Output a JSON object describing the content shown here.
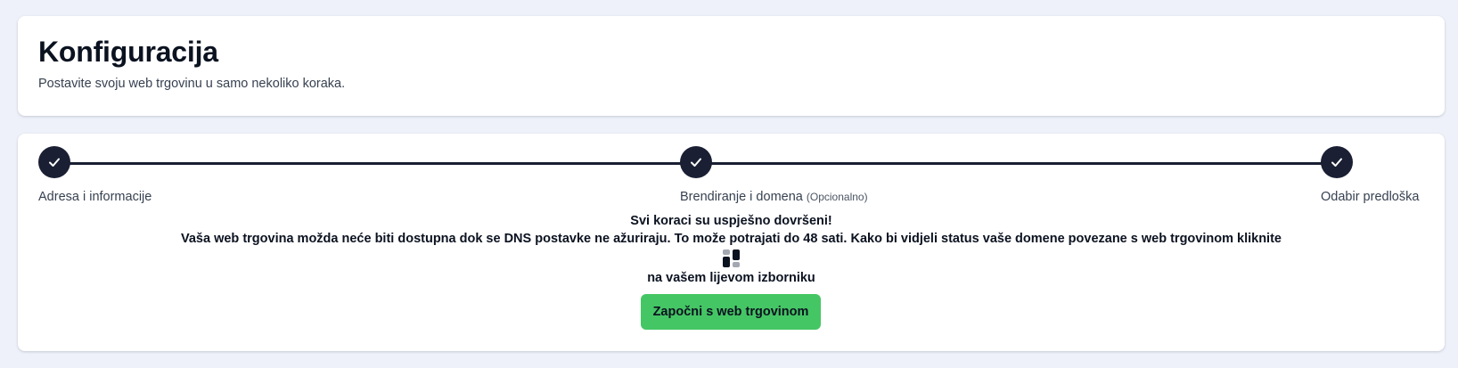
{
  "header": {
    "title": "Konfiguracija",
    "subtitle": "Postavite svoju web trgovinu u samo nekoliko koraka."
  },
  "steps": [
    {
      "label": "Adresa i informacije",
      "optional": "",
      "completed": true
    },
    {
      "label": "Brendiranje i domena",
      "optional": "(Opcionalno)",
      "completed": true
    },
    {
      "label": "Odabir predloška",
      "optional": "",
      "completed": true
    }
  ],
  "completion": {
    "title": "Svi koraci su uspješno dovršeni!",
    "message": "Vaša web trgovina možda neće biti dostupna dok se DNS postavke ne ažuriraju. To može potrajati do 48 sati. Kako bi vidjeli status vaše domene povezane s web trgovinom kliknite",
    "icon": "dashboard-icon",
    "after_icon": "na vašem lijevom izborniku"
  },
  "actions": {
    "start_label": "Započni s web trgovinom"
  },
  "colors": {
    "background": "#eef1f9",
    "card": "#ffffff",
    "step_complete": "#1a1f33",
    "button": "#45c664"
  }
}
